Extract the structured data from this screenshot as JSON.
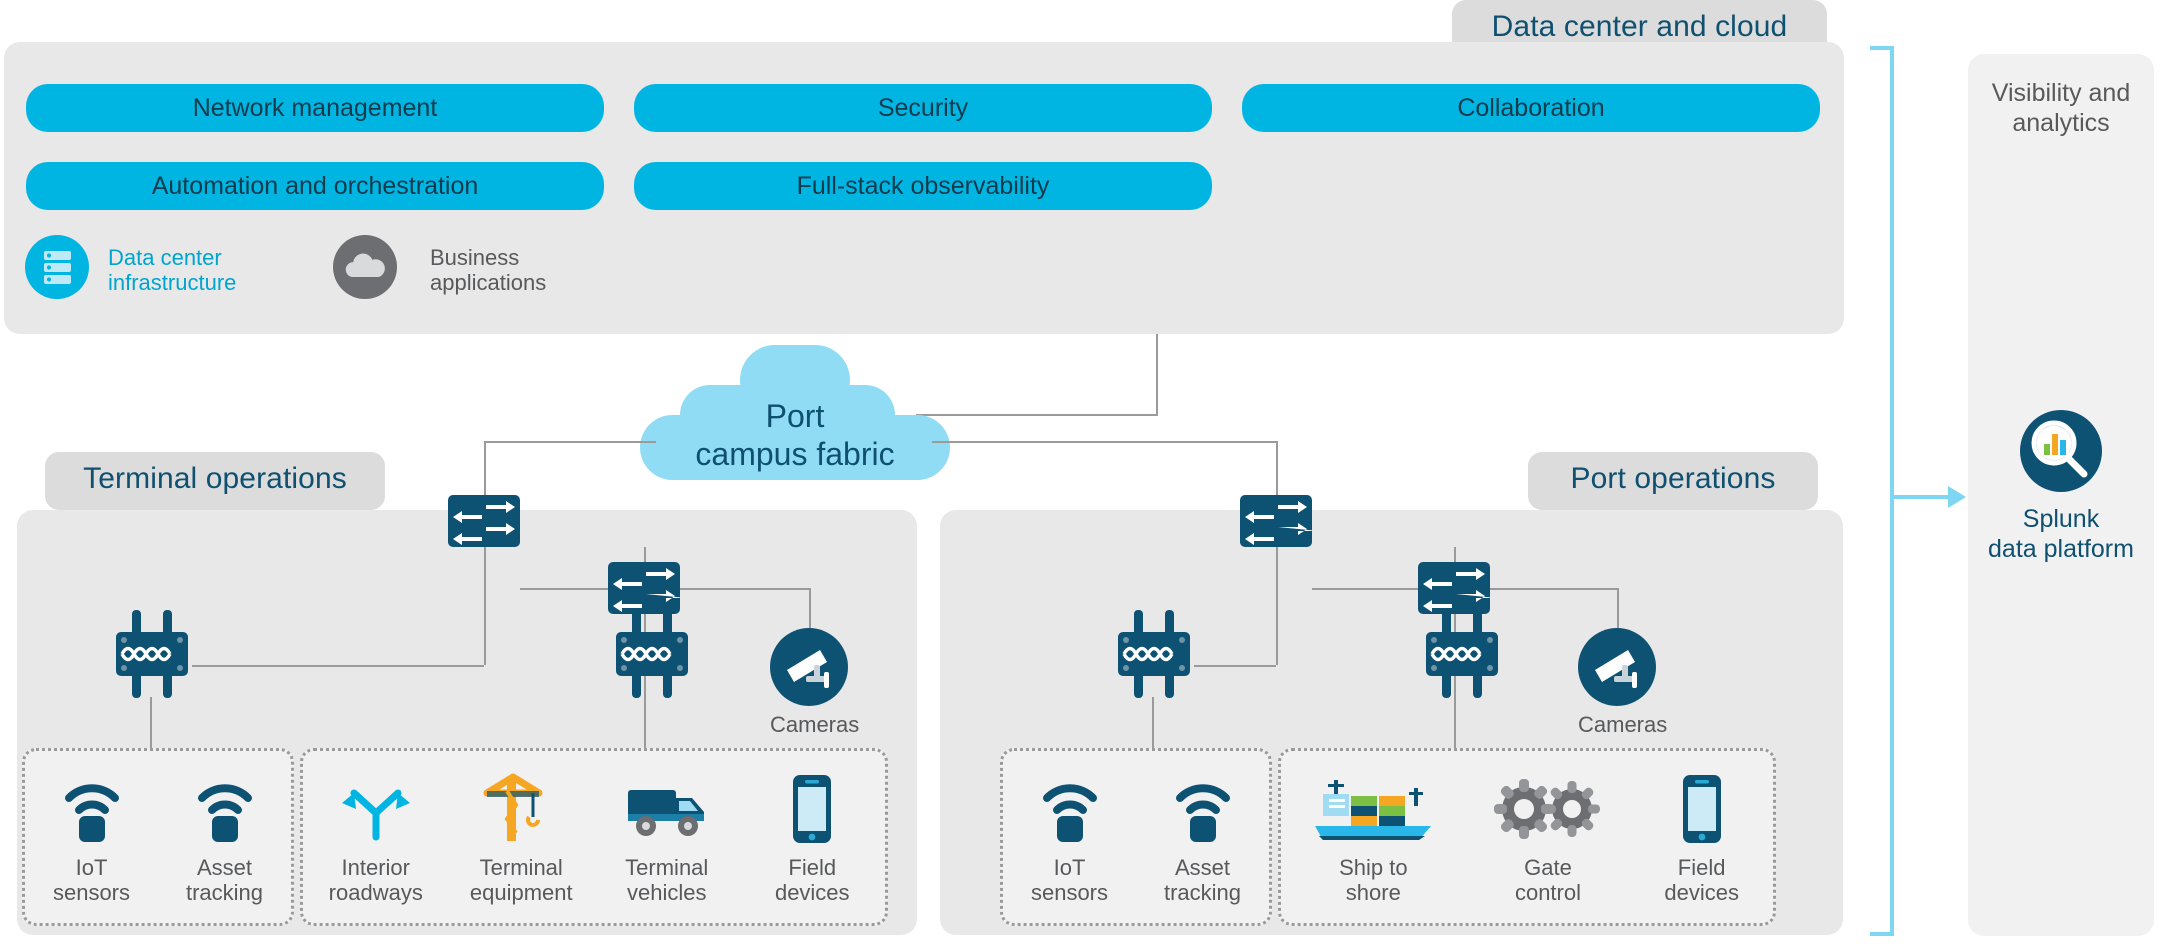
{
  "colors": {
    "cyan": "#00b5e2",
    "deep_blue": "#0d5272",
    "panel_grey": "#e8e8e8",
    "tab_grey": "#dcdcdc",
    "light_cloud": "#90dcf4",
    "bracket_blue": "#7fd6f2",
    "label_grey": "#58595b",
    "orange": "#f5a623",
    "green": "#7bc043"
  },
  "datacenter": {
    "tab_label": "Data center and cloud",
    "pills": [
      {
        "label": "Network management"
      },
      {
        "label": "Security"
      },
      {
        "label": "Collaboration"
      },
      {
        "label": "Automation and orchestration"
      },
      {
        "label": "Full-stack observability"
      }
    ],
    "nodes": [
      {
        "label": "Data center\ninfrastructure",
        "icon": "server-rack-icon",
        "style": "cyan"
      },
      {
        "label": "Business\napplications",
        "icon": "cloud-icon",
        "style": "grey"
      }
    ]
  },
  "fabric": {
    "label": "Port\ncampus fabric",
    "icon": "cloud-fabric-icon"
  },
  "terminal_operations": {
    "tab_label": "Terminal operations",
    "camera": {
      "label": "Cameras",
      "icon": "security-camera-icon"
    },
    "groups": [
      {
        "name": "sensors-group",
        "devices": [
          {
            "label": "IoT\nsensors",
            "icon": "iot-sensor-icon"
          },
          {
            "label": "Asset\ntracking",
            "icon": "asset-tracking-icon"
          }
        ]
      },
      {
        "name": "terminal-assets-group",
        "devices": [
          {
            "label": "Interior\nroadways",
            "icon": "road-fork-icon"
          },
          {
            "label": "Terminal\nequipment",
            "icon": "crane-icon"
          },
          {
            "label": "Terminal\nvehicles",
            "icon": "truck-icon"
          },
          {
            "label": "Field\ndevices",
            "icon": "smartphone-icon"
          }
        ]
      }
    ]
  },
  "port_operations": {
    "tab_label": "Port operations",
    "camera": {
      "label": "Cameras",
      "icon": "security-camera-icon"
    },
    "groups": [
      {
        "name": "sensors-group",
        "devices": [
          {
            "label": "IoT\nsensors",
            "icon": "iot-sensor-icon"
          },
          {
            "label": "Asset\ntracking",
            "icon": "asset-tracking-icon"
          }
        ]
      },
      {
        "name": "port-assets-group",
        "devices": [
          {
            "label": "Ship to\nshore",
            "icon": "container-ship-icon"
          },
          {
            "label": "Gate\ncontrol",
            "icon": "gears-icon"
          },
          {
            "label": "Field\ndevices",
            "icon": "smartphone-icon"
          }
        ]
      }
    ]
  },
  "visibility": {
    "title": "Visibility and\nanalytics",
    "platform_label": "Splunk\ndata platform",
    "platform_icon": "splunk-magnifier-chart-icon"
  }
}
